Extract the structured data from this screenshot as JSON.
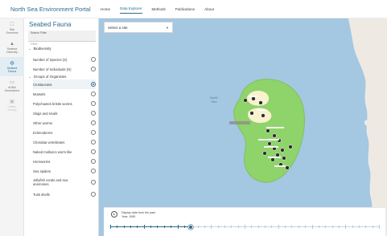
{
  "app": {
    "title": "North Sea Environment Portal"
  },
  "nav": {
    "items": [
      {
        "label": "Home",
        "active": false
      },
      {
        "label": "Data Explorer",
        "active": true
      },
      {
        "label": "Methods",
        "active": false
      },
      {
        "label": "Publications",
        "active": false
      },
      {
        "label": "About",
        "active": false
      }
    ]
  },
  "rail": {
    "items": [
      {
        "icon": "⛶",
        "icon_name": "map-icon",
        "label": "Site\nOverview"
      },
      {
        "icon": "▲",
        "icon_name": "chart-icon",
        "label": "Seabed\nDiversity"
      },
      {
        "icon": "◍",
        "icon_name": "fauna-icon",
        "label": "Seabed\nFauna"
      },
      {
        "icon": "▭",
        "icon_name": "edna-icon",
        "label": "eDNA\nDescriptors"
      },
      {
        "icon": "▣",
        "icon_name": "video-icon",
        "label": "Video\nSurvey"
      }
    ]
  },
  "panel": {
    "title": "Seabed Fauna",
    "filter": {
      "label": "Search Filter",
      "placeholder": "Filter"
    },
    "sections": {
      "biodiversity": "Biodiversity",
      "groups": "Groups of Organisms"
    },
    "biodiversity_items": [
      "Number of Species (S)",
      "Number of Individuals (N)"
    ],
    "group_items": [
      "Crustaceans",
      "Mussels",
      "Polychaetes bristle worms",
      "Slugs and snails",
      "Other worms",
      "Echinoderms",
      "Chordata vertebrates",
      "Naked molluscs worm like",
      "Hornworms",
      "Sea spiders",
      "Jellyfish corals and sea anemones",
      "Tusk shells"
    ],
    "selected_group": "Crustaceans"
  },
  "map": {
    "site_select": {
      "placeholder": "Select a site"
    },
    "sea_label": "North\nSea",
    "colors": {
      "sea": "#a4c7e2",
      "land": "#eeeae3",
      "zone": "#8fd36b",
      "sandbank": "#f8f2cf",
      "station": "#2f2f2f"
    }
  },
  "timeline": {
    "caption_line1": "Display data from the past",
    "caption_line2": "Year: 1995",
    "play_icon": "play-icon",
    "progress": 0.3
  }
}
